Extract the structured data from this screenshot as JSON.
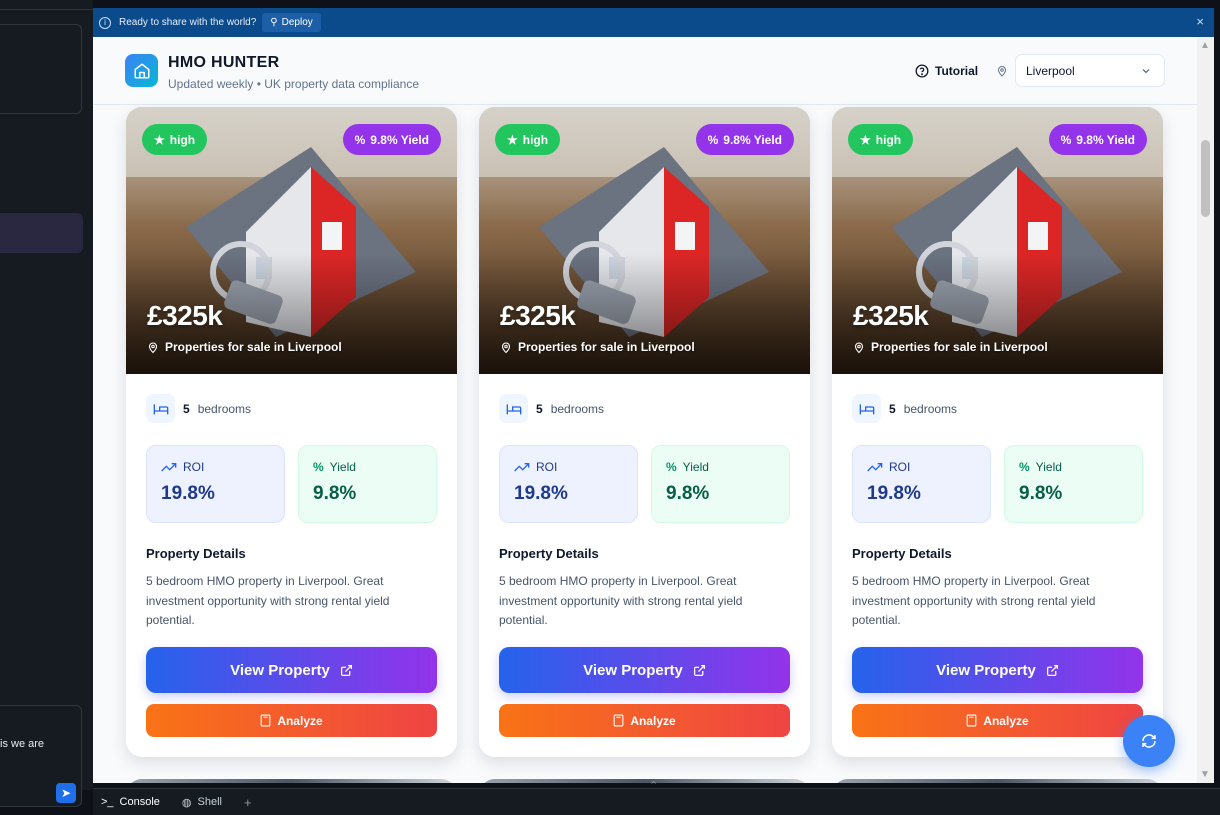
{
  "ide": {
    "chat_snippet": "is we are",
    "console_tab": "Console",
    "shell_tab": "Shell",
    "add_tab": "+"
  },
  "deploy_bar": {
    "message": "Ready to share with the world?",
    "deploy_label": "Deploy",
    "close": "×"
  },
  "header": {
    "title": "HMO HUNTER",
    "subtitle": "Updated weekly • UK property data compliance",
    "tutorial_label": "Tutorial",
    "city_selected": "Liverpool"
  },
  "colors": {
    "deploy_bar": "#0b4a8b",
    "high_badge": "#22c55e",
    "yield_badge": "#9333ea",
    "view_gradient_start": "#2563eb",
    "view_gradient_end": "#9333ea",
    "analyze_gradient_start": "#f97316",
    "analyze_gradient_end": "#ef4444",
    "fab": "#3b82f6"
  },
  "cards": [
    {
      "badge_rating": "high",
      "badge_yield": "9.8% Yield",
      "price": "£325k",
      "location": "Properties for sale in Liverpool",
      "bedrooms_count": "5",
      "bedrooms_label": "bedrooms",
      "roi_label": "ROI",
      "roi_value": "19.8%",
      "yield_label": "Yield",
      "yield_value": "9.8%",
      "details_title": "Property Details",
      "details_text": "5 bedroom HMO property in Liverpool. Great investment opportunity with strong rental yield potential.",
      "view_label": "View Property",
      "analyze_label": "Analyze"
    },
    {
      "badge_rating": "high",
      "badge_yield": "9.8% Yield",
      "price": "£325k",
      "location": "Properties for sale in Liverpool",
      "bedrooms_count": "5",
      "bedrooms_label": "bedrooms",
      "roi_label": "ROI",
      "roi_value": "19.8%",
      "yield_label": "Yield",
      "yield_value": "9.8%",
      "details_title": "Property Details",
      "details_text": "5 bedroom HMO property in Liverpool. Great investment opportunity with strong rental yield potential.",
      "view_label": "View Property",
      "analyze_label": "Analyze"
    },
    {
      "badge_rating": "high",
      "badge_yield": "9.8% Yield",
      "price": "£325k",
      "location": "Properties for sale in Liverpool",
      "bedrooms_count": "5",
      "bedrooms_label": "bedrooms",
      "roi_label": "ROI",
      "roi_value": "19.8%",
      "yield_label": "Yield",
      "yield_value": "9.8%",
      "details_title": "Property Details",
      "details_text": "5 bedroom HMO property in Liverpool. Great investment opportunity with strong rental yield potential.",
      "view_label": "View Property",
      "analyze_label": "Analyze"
    }
  ]
}
